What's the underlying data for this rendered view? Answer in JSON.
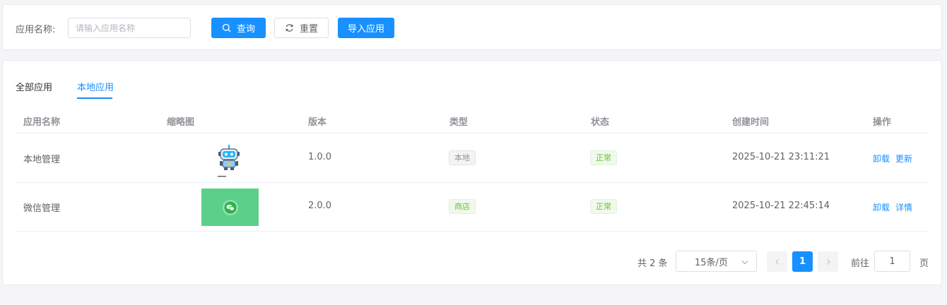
{
  "search": {
    "label": "应用名称:",
    "placeholder": "请输入应用名称",
    "query_label": "查询",
    "reset_label": "重置",
    "import_label": "导入应用"
  },
  "tabs": [
    {
      "label": "全部应用",
      "active": false
    },
    {
      "label": "本地应用",
      "active": true
    }
  ],
  "table": {
    "headers": [
      "应用名称",
      "缩略图",
      "版本",
      "类型",
      "状态",
      "创建时间",
      "操作"
    ],
    "rows": [
      {
        "name": "本地管理",
        "thumbnail": "robot-icon",
        "version": "1.0.0",
        "type": "本地",
        "status": "正常",
        "created": "2025-10-21 23:11:21",
        "actions": [
          "卸载",
          "更新"
        ]
      },
      {
        "name": "微信管理",
        "thumbnail": "wechat-icon",
        "version": "2.0.0",
        "type": "商店",
        "status": "正常",
        "created": "2025-10-21 22:45:14",
        "actions": [
          "卸载",
          "详情"
        ]
      }
    ]
  },
  "pagination": {
    "total_text": "共 2 条",
    "page_size": "15条/页",
    "current_page": "1",
    "goto_label": "前往",
    "goto_value": "1",
    "page_suffix": "页"
  },
  "colors": {
    "primary": "#1890ff",
    "success": "#67c23a",
    "wechat_green": "#5cd08a"
  }
}
